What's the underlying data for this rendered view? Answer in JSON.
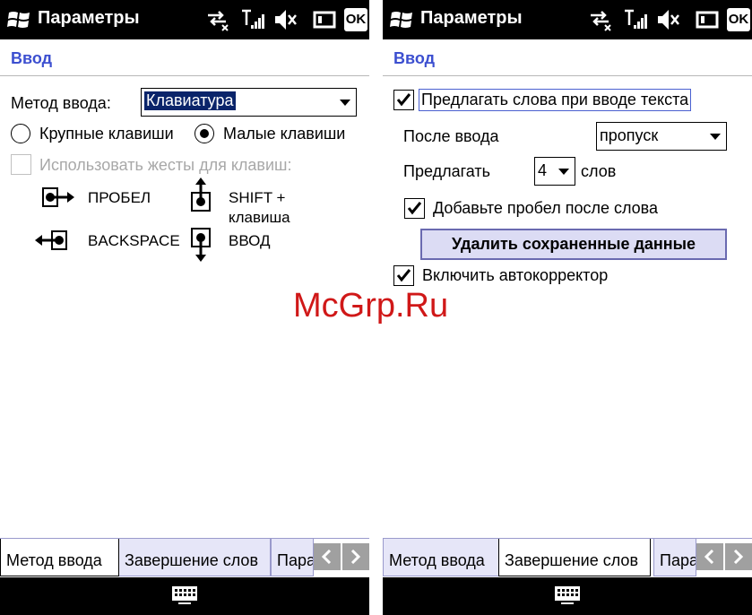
{
  "status": {
    "title": "Параметры",
    "ok_label": "OK"
  },
  "left": {
    "heading": "Ввод",
    "input_method_label": "Метод ввода:",
    "input_method_value": "Клавиатура",
    "radio_large": "Крупные клавиши",
    "radio_small": "Малые клавиши",
    "radio_selected": "small",
    "gestures_checkbox": "Использовать жесты для клавиш:",
    "gestures_enabled": false,
    "gestures": [
      {
        "icon": "space-gesture-icon",
        "label": "ПРОБЕЛ"
      },
      {
        "icon": "shift-gesture-icon",
        "label": "SHIFT +",
        "label2": "клавиша"
      },
      {
        "icon": "backspace-gesture-icon",
        "label": "BACKSPACE"
      },
      {
        "icon": "enter-gesture-icon",
        "label": "ВВОД"
      }
    ],
    "tabs": [
      "Метод ввода",
      "Завершение слов",
      "Пара"
    ],
    "active_tab": 0
  },
  "right": {
    "heading": "Ввод",
    "suggest_words": "Предлагать слова при вводе текста",
    "suggest_words_checked": true,
    "after_input_label": "После ввода",
    "after_input_value": "пропуск",
    "suggest_label": "Предлагать",
    "suggest_count": "4",
    "words_label": "слов",
    "add_space": "Добавьте пробел после слова",
    "add_space_checked": true,
    "delete_button": "Удалить сохраненные данные",
    "autocorrect": "Включить автокорректор",
    "autocorrect_checked": true,
    "tabs": [
      "Метод ввода",
      "Завершение слов",
      "Пара"
    ],
    "active_tab": 1
  },
  "watermark": "McGrp.Ru",
  "colors": {
    "heading_blue": "#3c4fd0",
    "selection_blue": "#0a246a",
    "tab_inactive": "#e6e6f8",
    "button_face": "#dcdcf4"
  }
}
